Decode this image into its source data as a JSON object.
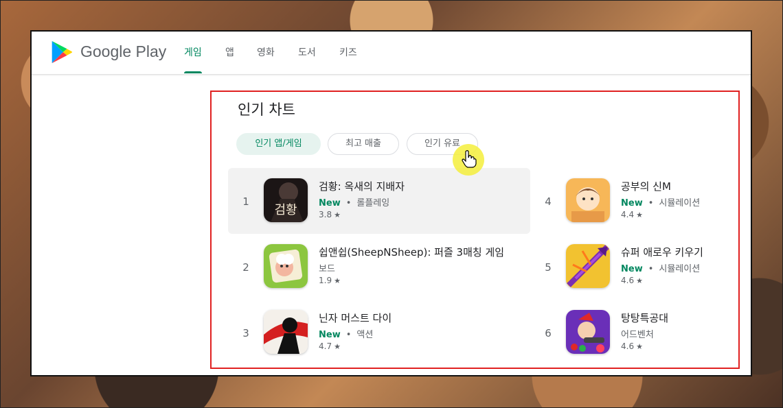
{
  "brand": "Google Play",
  "nav_tabs": [
    "게임",
    "앱",
    "영화",
    "도서",
    "키즈"
  ],
  "section_title": "인기 차트",
  "chips": [
    "인기 앱/게임",
    "최고 매출",
    "인기 유료"
  ],
  "new_label": "New",
  "separator": "•",
  "star": "★",
  "apps": [
    {
      "rank": "1",
      "title": "검황: 옥새의 지배자",
      "category": "롤플레잉",
      "rating": "3.8",
      "is_new": true
    },
    {
      "rank": "2",
      "title": "쉽앤쉽(SheepNSheep): 퍼즐 3매칭 게임",
      "category": "보드",
      "rating": "1.9",
      "is_new": false
    },
    {
      "rank": "3",
      "title": "닌자 머스트 다이",
      "category": "액션",
      "rating": "4.7",
      "is_new": true
    },
    {
      "rank": "4",
      "title": "공부의 신M",
      "category": "시뮬레이션",
      "rating": "4.4",
      "is_new": true
    },
    {
      "rank": "5",
      "title": "슈퍼 애로우 키우기",
      "category": "시뮬레이션",
      "rating": "4.6",
      "is_new": true
    },
    {
      "rank": "6",
      "title": "탕탕특공대",
      "category": "어드벤처",
      "rating": "4.6",
      "is_new": false
    }
  ],
  "colors": {
    "accent": "#01875f",
    "highlight_box": "#e02020",
    "cursor_glow": "#f4ee3c"
  }
}
